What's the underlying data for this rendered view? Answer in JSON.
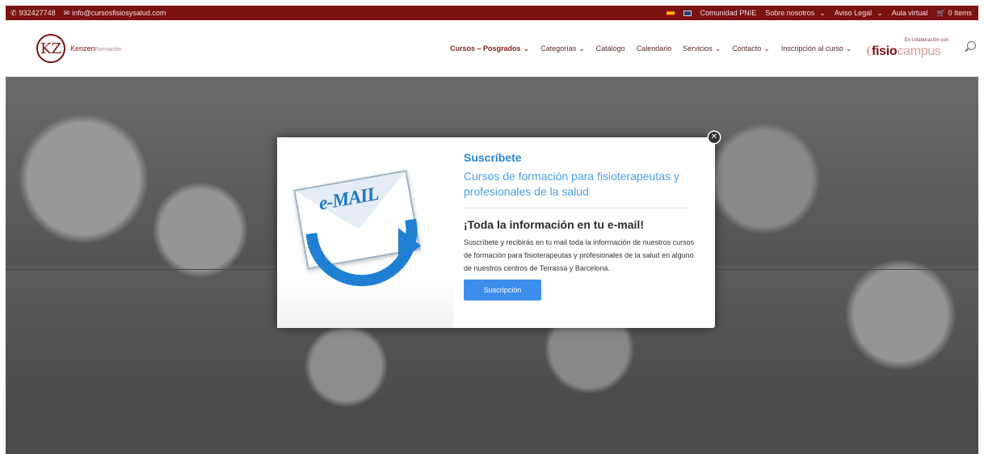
{
  "topbar": {
    "phone": "932427748",
    "email": "info@cursosfisiosysalud.com",
    "links": [
      "Comunidad PNIE",
      "Sobre nosotros",
      "Aviso Legal",
      "Aula virtual"
    ],
    "cart": "0 Items"
  },
  "header": {
    "logo_initials": "KZ",
    "logo_name": "Kenzen",
    "logo_sub": "Formación",
    "nav": [
      "Cursos – Posgrados",
      "Categorías",
      "Catálogo",
      "Calendario",
      "Servicios",
      "Contacto",
      "Inscripción al curso"
    ],
    "partner_small": "En colaboración con",
    "partner_main": "fisio",
    "partner_sub": "campus"
  },
  "modal": {
    "image_text": "e-MAIL",
    "title": "Suscríbete",
    "subtitle": "Cursos de formación para fisioterapeutas y profesionales de la salud",
    "heading": "¡Toda la información en tu e-mail!",
    "body": "Suscríbete y recibirás en tu mail toda la información de nuestros cursos de formación para fisioterapeutas y profesionales de la salud en alguno de nuestros centros de Terrassa y Barcelona.",
    "button": "Suscripción",
    "colors": {
      "accent": "#2a84dc",
      "button": "#3d8eea",
      "brand": "#7a1212"
    }
  }
}
